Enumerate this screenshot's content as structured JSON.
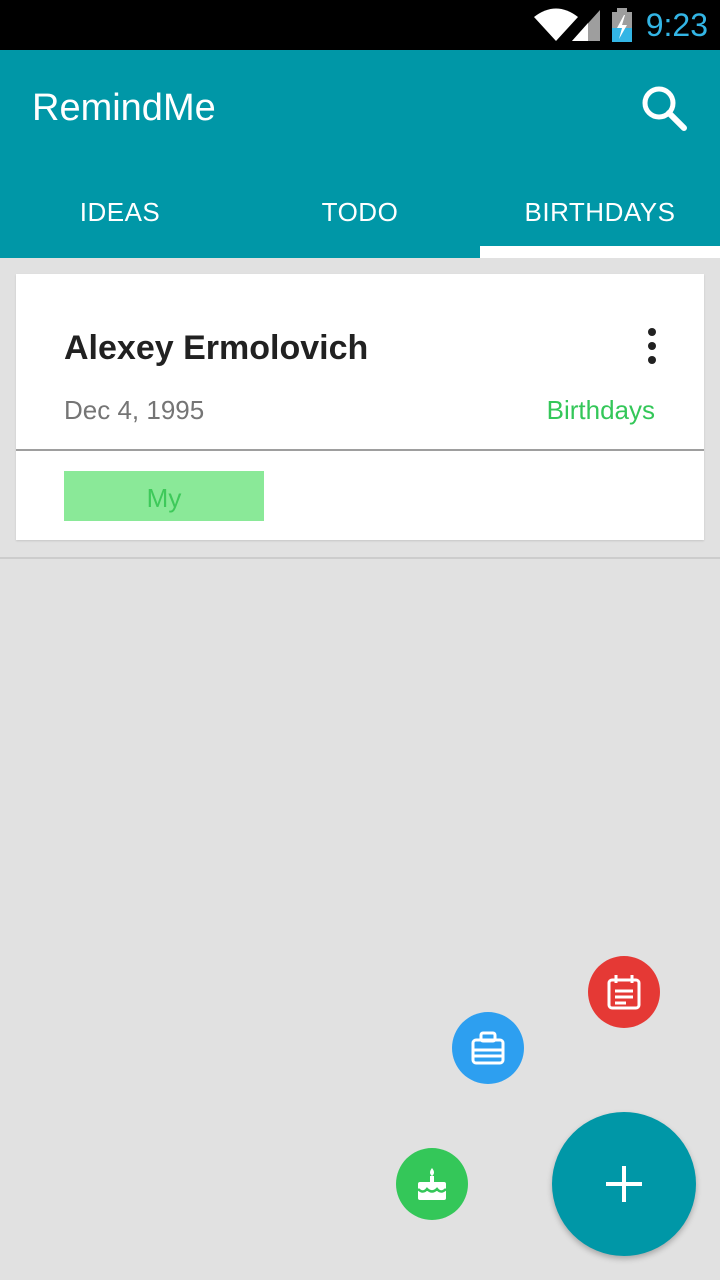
{
  "status_bar": {
    "time": "9:23",
    "time_color": "#33b5e5",
    "icons": [
      "wifi-icon",
      "cell-signal-icon",
      "battery-charging-icon"
    ]
  },
  "app_bar": {
    "title": "RemindMe",
    "color": "#0097a7",
    "search_icon": "search-icon"
  },
  "tabs": {
    "items": [
      {
        "label": "IDEAS"
      },
      {
        "label": "TODO"
      },
      {
        "label": "BIRTHDAYS"
      }
    ],
    "selected": "BIRTHDAYS"
  },
  "reminders": [
    {
      "name": "Alexey Ermolovich",
      "date": "Dec 4, 1995",
      "category": "Birthdays",
      "category_color": "#34c759",
      "tag": "My",
      "tag_color": "#8ae998",
      "menu_icon": "more-vert-icon"
    }
  ],
  "fab_menu": {
    "main_icon": "plus-icon",
    "actions": [
      {
        "icon": "calendar-note-icon",
        "color": "#e53935"
      },
      {
        "icon": "briefcase-icon",
        "color": "#2d9ff0"
      },
      {
        "icon": "cake-icon",
        "color": "#34c759"
      }
    ]
  }
}
